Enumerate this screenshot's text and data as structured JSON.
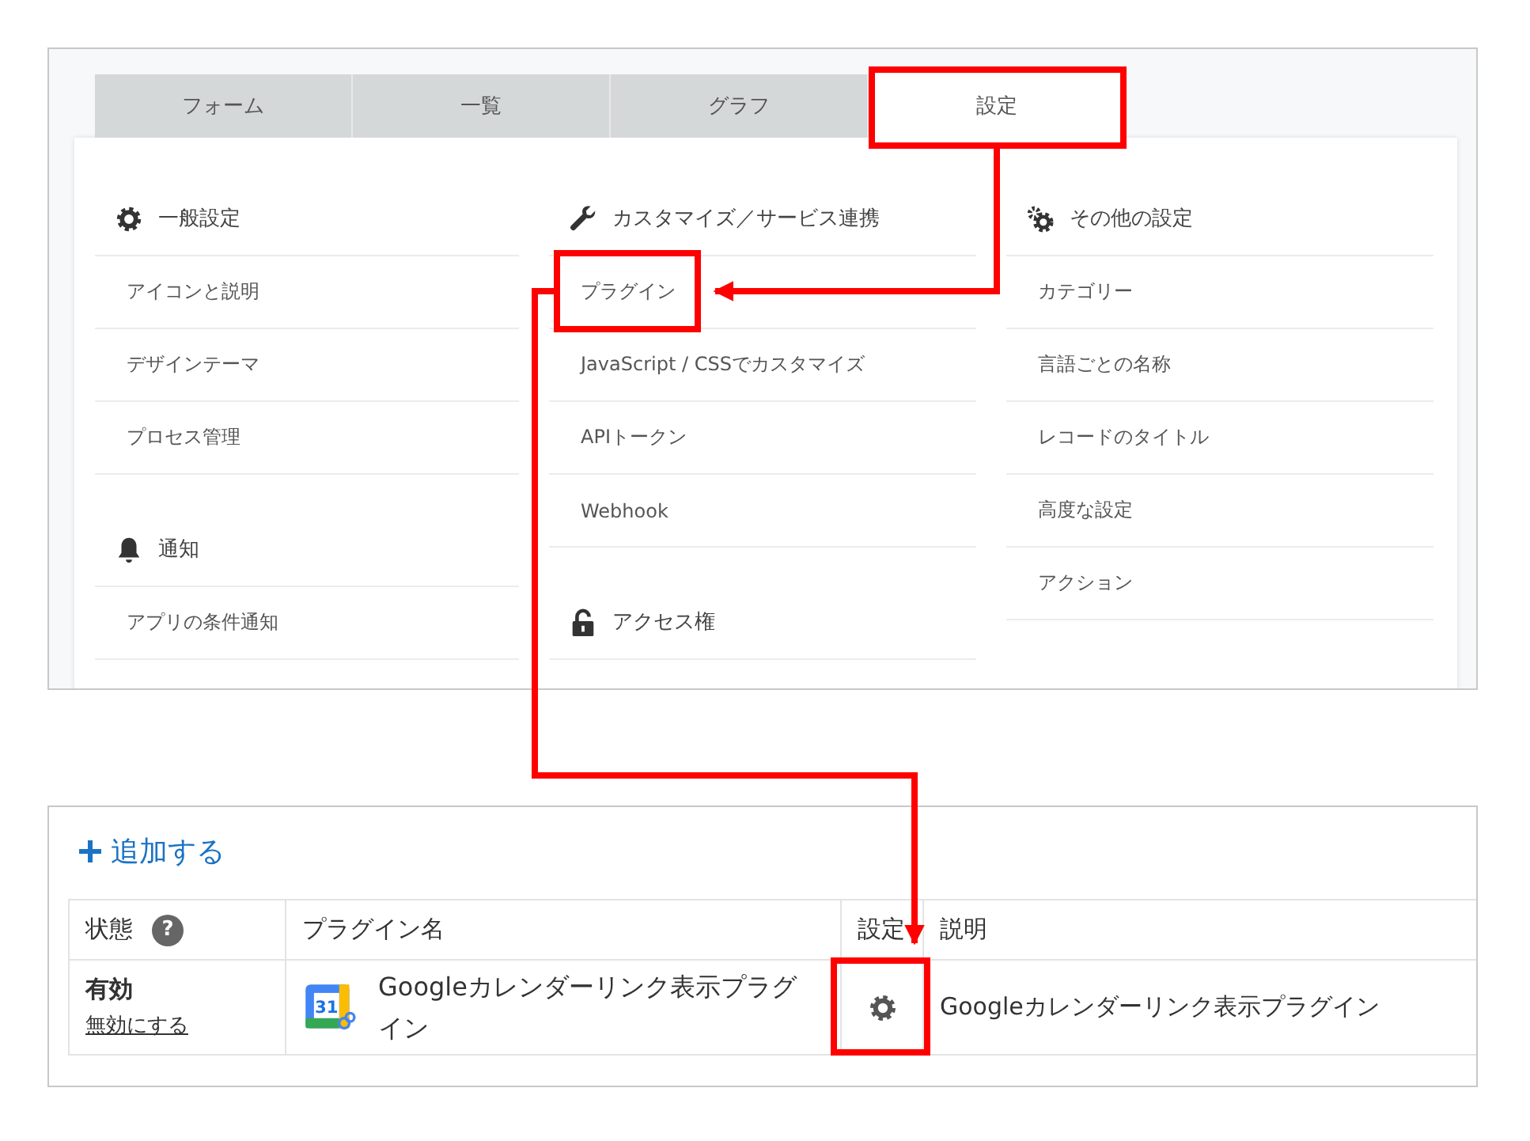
{
  "tabs": [
    {
      "label": "フォーム",
      "selected": false
    },
    {
      "label": "一覧",
      "selected": false
    },
    {
      "label": "グラフ",
      "selected": false
    },
    {
      "label": "設定",
      "selected": true
    }
  ],
  "settings_columns": [
    {
      "sections": [
        {
          "heading": "一般設定",
          "items": [
            "アイコンと説明",
            "デザインテーマ",
            "プロセス管理"
          ]
        },
        {
          "heading": "通知",
          "items": [
            "アプリの条件通知"
          ]
        }
      ]
    },
    {
      "sections": [
        {
          "heading": "カスタマイズ／サービス連携",
          "items": [
            "プラグイン",
            "JavaScript / CSSでカスタマイズ",
            "APIトークン",
            "Webhook"
          ]
        },
        {
          "heading": "アクセス権"
        }
      ]
    },
    {
      "sections": [
        {
          "heading": "その他の設定",
          "items": [
            "カテゴリー",
            "言語ごとの名称",
            "レコードのタイトル",
            "高度な設定",
            "アクション"
          ]
        }
      ]
    }
  ],
  "plugin_list": {
    "add_button": "追加する",
    "columns": [
      {
        "label": "状態",
        "help": "?"
      },
      {
        "label": "プラグイン名"
      },
      {
        "label": "設定"
      },
      {
        "label": "説明"
      }
    ],
    "rows": [
      {
        "status": "有効",
        "disable_link": "無効にする",
        "icon_label": "31",
        "name": "Googleカレンダーリンク表示プラグイン",
        "description": "Googleカレンダーリンク表示プラグイン"
      }
    ]
  }
}
